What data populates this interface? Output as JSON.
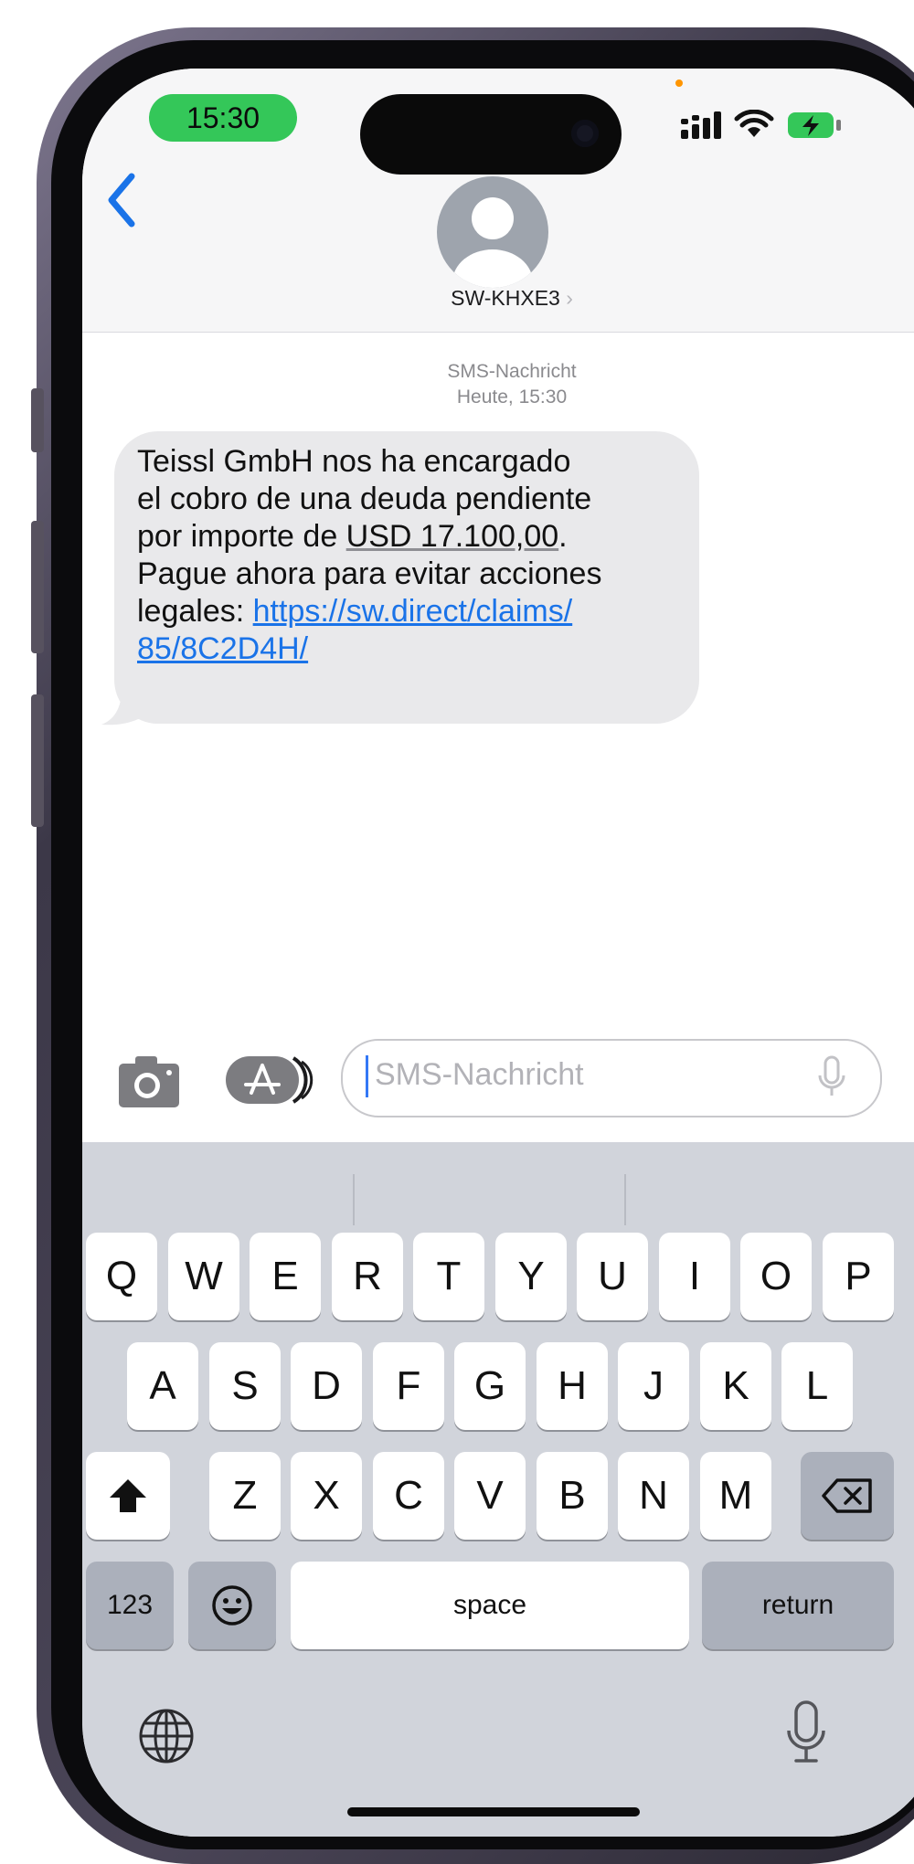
{
  "status_bar": {
    "time": "15:30"
  },
  "header": {
    "contact_name": "SW-KHXE3",
    "contact_chevron": "›"
  },
  "thread": {
    "service_label": "SMS-Nachricht",
    "timestamp": "Heute, 15:30",
    "message": {
      "lines": [
        "Teissl GmbH nos ha encargado",
        "el cobro de una deuda pendiente"
      ],
      "line3_prefix": "por importe de ",
      "amount": "USD 17.100,00",
      "line3_suffix": ".",
      "line4": "Pague ahora para evitar acciones",
      "line5_prefix": "legales: ",
      "link_part1": "https://sw.direct/claims/",
      "link_part2": "85/8C2D4H/"
    }
  },
  "composer": {
    "placeholder": "SMS-Nachricht"
  },
  "keyboard": {
    "row1": [
      "Q",
      "W",
      "E",
      "R",
      "T",
      "Y",
      "U",
      "I",
      "O",
      "P"
    ],
    "row2": [
      "A",
      "S",
      "D",
      "F",
      "G",
      "H",
      "J",
      "K",
      "L"
    ],
    "row3": [
      "Z",
      "X",
      "C",
      "V",
      "B",
      "N",
      "M"
    ],
    "numbers_label": "123",
    "space_label": "space",
    "return_label": "return"
  },
  "icons": {
    "back": "chevron-left-icon",
    "camera": "camera-icon",
    "app_store": "app-store-icon",
    "mic": "microphone-icon",
    "shift": "shift-icon",
    "delete": "delete-icon",
    "emoji": "emoji-icon",
    "globe": "globe-icon",
    "dictation": "microphone-icon"
  },
  "colors": {
    "accent": "#1a73e8",
    "time_pill": "#34c759",
    "bubble": "#e9e9eb",
    "keyboard_bg": "#d1d4db"
  }
}
